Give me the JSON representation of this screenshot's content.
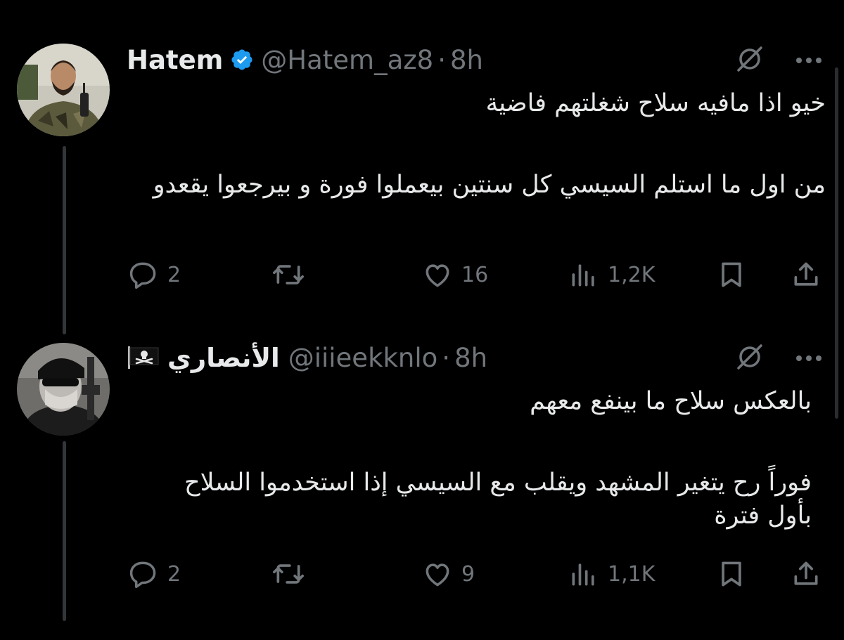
{
  "tweets": [
    {
      "display_name": "Hatem",
      "handle": "@Hatem_az8",
      "separator": "·",
      "time": "8h",
      "verified": true,
      "avatar_icon": "soldier-avatar",
      "text_line_1": "خيو اذا مافيه سلاح شغلتهم فاضية",
      "text_line_2": "من اول ما استلم السيسي كل سنتين بيعملوا فورة و بيرجعوا يقعدو",
      "replies": "2",
      "likes": "16",
      "views": "1,2K"
    },
    {
      "display_name": "الأنصاري",
      "handle": "@iiieekknlo",
      "separator": "·",
      "time": "8h",
      "verified": false,
      "flag_icon": "pirate-flag-icon",
      "avatar_icon": "masked-avatar",
      "text_line_1": "بالعكس سلاح ما بينفع معهم",
      "text_line_2": "فوراً رح يتغير المشهد ويقلب مع السيسي إذا استخدموا السلاح بأول فترة",
      "replies": "2",
      "likes": "9",
      "views": "1,1K"
    }
  ],
  "colors": {
    "background": "#000000",
    "text_primary": "#e7e9ea",
    "text_secondary": "#71767b",
    "verified_blue": "#1d9bf0",
    "thread_line": "#333639"
  },
  "icons": {
    "reply": "speech-bubble-icon",
    "retweet": "retweet-icon",
    "like": "heart-icon",
    "views": "bar-chart-icon",
    "bookmark": "bookmark-icon",
    "share": "share-icon",
    "grok": "grok-icon",
    "more": "more-dots-icon"
  }
}
